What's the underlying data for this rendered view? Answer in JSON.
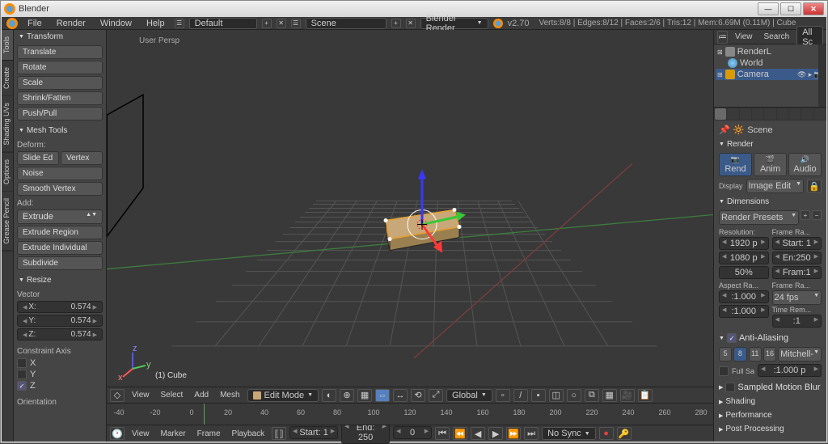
{
  "window": {
    "title": "Blender"
  },
  "info": {
    "menus": [
      "File",
      "Render",
      "Window",
      "Help"
    ],
    "layout": "Default",
    "scene": "Scene",
    "engine": "Blender Render",
    "version": "v2.70",
    "stats": "Verts:8/8 | Edges:8/12 | Faces:2/6 | Tris:12 | Mem:6.69M (0.11M) | Cube"
  },
  "vtabs": [
    "Tools",
    "Create",
    "Shading UVs",
    "Options",
    "Grease Pencil"
  ],
  "tool_panel": {
    "transform_hdr": "Transform",
    "transform": [
      "Translate",
      "Rotate",
      "Scale",
      "Shrink/Fatten",
      "Push/Pull"
    ],
    "meshtools_hdr": "Mesh Tools",
    "deform_lbl": "Deform:",
    "deform": [
      "Slide Ed",
      "Vertex"
    ],
    "noise": "Noise",
    "smooth": "Smooth Vertex",
    "add_lbl": "Add:",
    "extrude": "Extrude",
    "extrude_region": "Extrude Region",
    "extrude_ind": "Extrude Individual",
    "subdivide": "Subdivide",
    "resize_hdr": "Resize",
    "vector_lbl": "Vector",
    "vec_x": {
      "label": "X:",
      "value": "0.574"
    },
    "vec_y": {
      "label": "Y:",
      "value": "0.574"
    },
    "vec_z": {
      "label": "Z:",
      "value": "0.574"
    },
    "constraint_lbl": "Constraint Axis",
    "cx": "X",
    "cy": "Y",
    "cz": "Z",
    "orientation_lbl": "Orientation"
  },
  "view3d": {
    "persp": "User Persp",
    "obj": "(1) Cube",
    "menus": [
      "View",
      "Select",
      "Add",
      "Mesh"
    ],
    "mode": "Edit Mode",
    "orient": "Global"
  },
  "timeline": {
    "menus": [
      "View",
      "Marker",
      "Frame",
      "Playback"
    ],
    "ticks": [
      "-40",
      "-20",
      "0",
      "20",
      "40",
      "60",
      "80",
      "100",
      "120",
      "140",
      "160",
      "180",
      "200",
      "220",
      "240",
      "260",
      "280"
    ],
    "start_lbl": "Start:",
    "start_v": "1",
    "end_lbl": "End:",
    "end_v": "250",
    "cur_v": "0",
    "sync": "No Sync"
  },
  "outliner": {
    "menus": [
      "View",
      "Search"
    ],
    "all": "All Sc",
    "items": [
      "RenderL",
      "World",
      "Camera"
    ]
  },
  "props": {
    "breadcrumb": "Scene",
    "render_hdr": "Render",
    "render_btns": [
      "Rend",
      "Anim",
      "Audio"
    ],
    "display_lbl": "Display",
    "display_val": "Image Edit",
    "dims_hdr": "Dimensions",
    "presets": "Render Presets",
    "res_lbl": "Resolution:",
    "res_x": "1920 p",
    "res_y": "1080 p",
    "res_pct": "50%",
    "frame_lbl": "Frame Ra...",
    "frame_start": "Start: 1",
    "frame_end": "En:250",
    "frame_step": "Fram:1",
    "aspect_lbl": "Aspect Ra...",
    "aspect_x": ":1.000",
    "aspect_y": ":1.000",
    "fps_lbl": "Frame Ra...",
    "fps_v": "24 fps",
    "time_lbl": "Time Rem...",
    "time_v": ":1",
    "aa_hdr": "Anti-Aliasing",
    "aa_opts": [
      "5",
      "8",
      "11",
      "16"
    ],
    "aa_filter": "Mitchell-",
    "fullsa_lbl": "Full Sa",
    "fullsa_v": ":1.000 p",
    "panels_closed": [
      "Sampled Motion Blur",
      "Shading",
      "Performance",
      "Post Processing"
    ]
  }
}
